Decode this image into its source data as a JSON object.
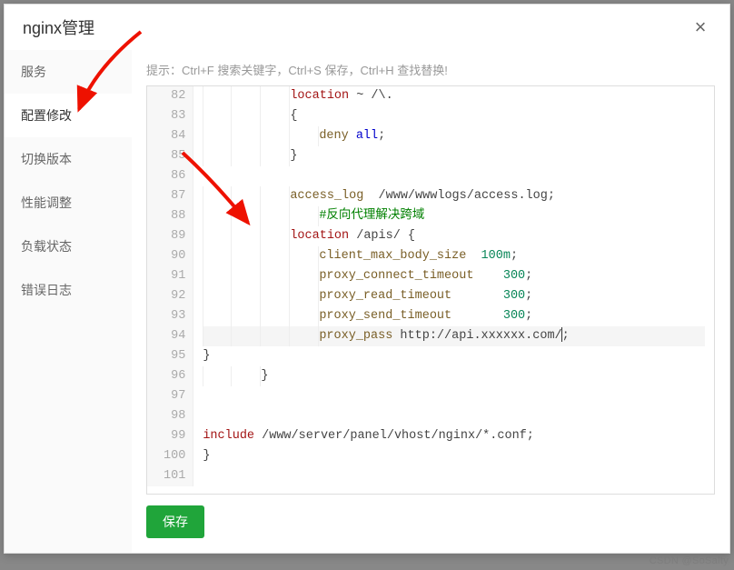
{
  "modal": {
    "title": "nginx管理",
    "close_label": "×"
  },
  "sidebar": {
    "items": [
      {
        "label": "服务",
        "active": false
      },
      {
        "label": "配置修改",
        "active": true
      },
      {
        "label": "切换版本",
        "active": false
      },
      {
        "label": "性能调整",
        "active": false
      },
      {
        "label": "负载状态",
        "active": false
      },
      {
        "label": "错误日志",
        "active": false
      }
    ]
  },
  "hint": "提示：Ctrl+F 搜索关键字，Ctrl+S 保存，Ctrl+H 查找替换!",
  "editor": {
    "first_line": 82,
    "active_line": 94,
    "lines": [
      {
        "n": 82,
        "indent": 3,
        "tokens": [
          {
            "t": "location",
            "c": "kw"
          },
          {
            "t": " ~ /\\.",
            "c": "punc"
          }
        ]
      },
      {
        "n": 83,
        "indent": 3,
        "tokens": [
          {
            "t": "{",
            "c": "punc"
          }
        ]
      },
      {
        "n": 84,
        "indent": 4,
        "tokens": [
          {
            "t": "deny",
            "c": "dir"
          },
          {
            "t": " ",
            "c": "punc"
          },
          {
            "t": "all",
            "c": "sym"
          },
          {
            "t": ";",
            "c": "punc"
          }
        ]
      },
      {
        "n": 85,
        "indent": 3,
        "tokens": [
          {
            "t": "}",
            "c": "punc"
          }
        ]
      },
      {
        "n": 86,
        "indent": 0,
        "tokens": []
      },
      {
        "n": 87,
        "indent": 3,
        "tokens": [
          {
            "t": "access_log",
            "c": "dir"
          },
          {
            "t": "  /www/wwwlogs/access.log;",
            "c": "punc"
          }
        ]
      },
      {
        "n": 88,
        "indent": 4,
        "tokens": [
          {
            "t": "#反向代理解决跨域",
            "c": "cmt"
          }
        ]
      },
      {
        "n": 89,
        "indent": 3,
        "tokens": [
          {
            "t": "location",
            "c": "kw"
          },
          {
            "t": " /apis/ {",
            "c": "punc"
          }
        ]
      },
      {
        "n": 90,
        "indent": 4,
        "tokens": [
          {
            "t": "client_max_body_size",
            "c": "dir"
          },
          {
            "t": "  ",
            "c": "punc"
          },
          {
            "t": "100m",
            "c": "num"
          },
          {
            "t": ";",
            "c": "punc"
          }
        ]
      },
      {
        "n": 91,
        "indent": 4,
        "tokens": [
          {
            "t": "proxy_connect_timeout",
            "c": "dir"
          },
          {
            "t": "    ",
            "c": "punc"
          },
          {
            "t": "300",
            "c": "num"
          },
          {
            "t": ";",
            "c": "punc"
          }
        ]
      },
      {
        "n": 92,
        "indent": 4,
        "tokens": [
          {
            "t": "proxy_read_timeout",
            "c": "dir"
          },
          {
            "t": "       ",
            "c": "punc"
          },
          {
            "t": "300",
            "c": "num"
          },
          {
            "t": ";",
            "c": "punc"
          }
        ]
      },
      {
        "n": 93,
        "indent": 4,
        "tokens": [
          {
            "t": "proxy_send_timeout",
            "c": "dir"
          },
          {
            "t": "       ",
            "c": "punc"
          },
          {
            "t": "300",
            "c": "num"
          },
          {
            "t": ";",
            "c": "punc"
          }
        ]
      },
      {
        "n": 94,
        "indent": 4,
        "tokens": [
          {
            "t": "proxy_pass",
            "c": "dir"
          },
          {
            "t": " http://api.xxxxxx.com/",
            "c": "punc"
          },
          {
            "t": "CURSOR",
            "c": "cursor"
          },
          {
            "t": ";",
            "c": "punc"
          }
        ]
      },
      {
        "n": 95,
        "indent": 0,
        "tokens": [
          {
            "t": "}",
            "c": "punc"
          }
        ]
      },
      {
        "n": 96,
        "indent": 2,
        "tokens": [
          {
            "t": "}",
            "c": "punc"
          }
        ]
      },
      {
        "n": 97,
        "indent": 0,
        "tokens": []
      },
      {
        "n": 98,
        "indent": 0,
        "tokens": []
      },
      {
        "n": 99,
        "indent": 0,
        "tokens": [
          {
            "t": "include",
            "c": "kw"
          },
          {
            "t": " /www/server/panel/vhost/nginx/*.conf;",
            "c": "punc"
          }
        ]
      },
      {
        "n": 100,
        "indent": 0,
        "tokens": [
          {
            "t": "}",
            "c": "punc"
          }
        ]
      },
      {
        "n": 101,
        "indent": 0,
        "tokens": []
      }
    ]
  },
  "buttons": {
    "save": "保存"
  },
  "watermark": "CSDN @SoSalty"
}
